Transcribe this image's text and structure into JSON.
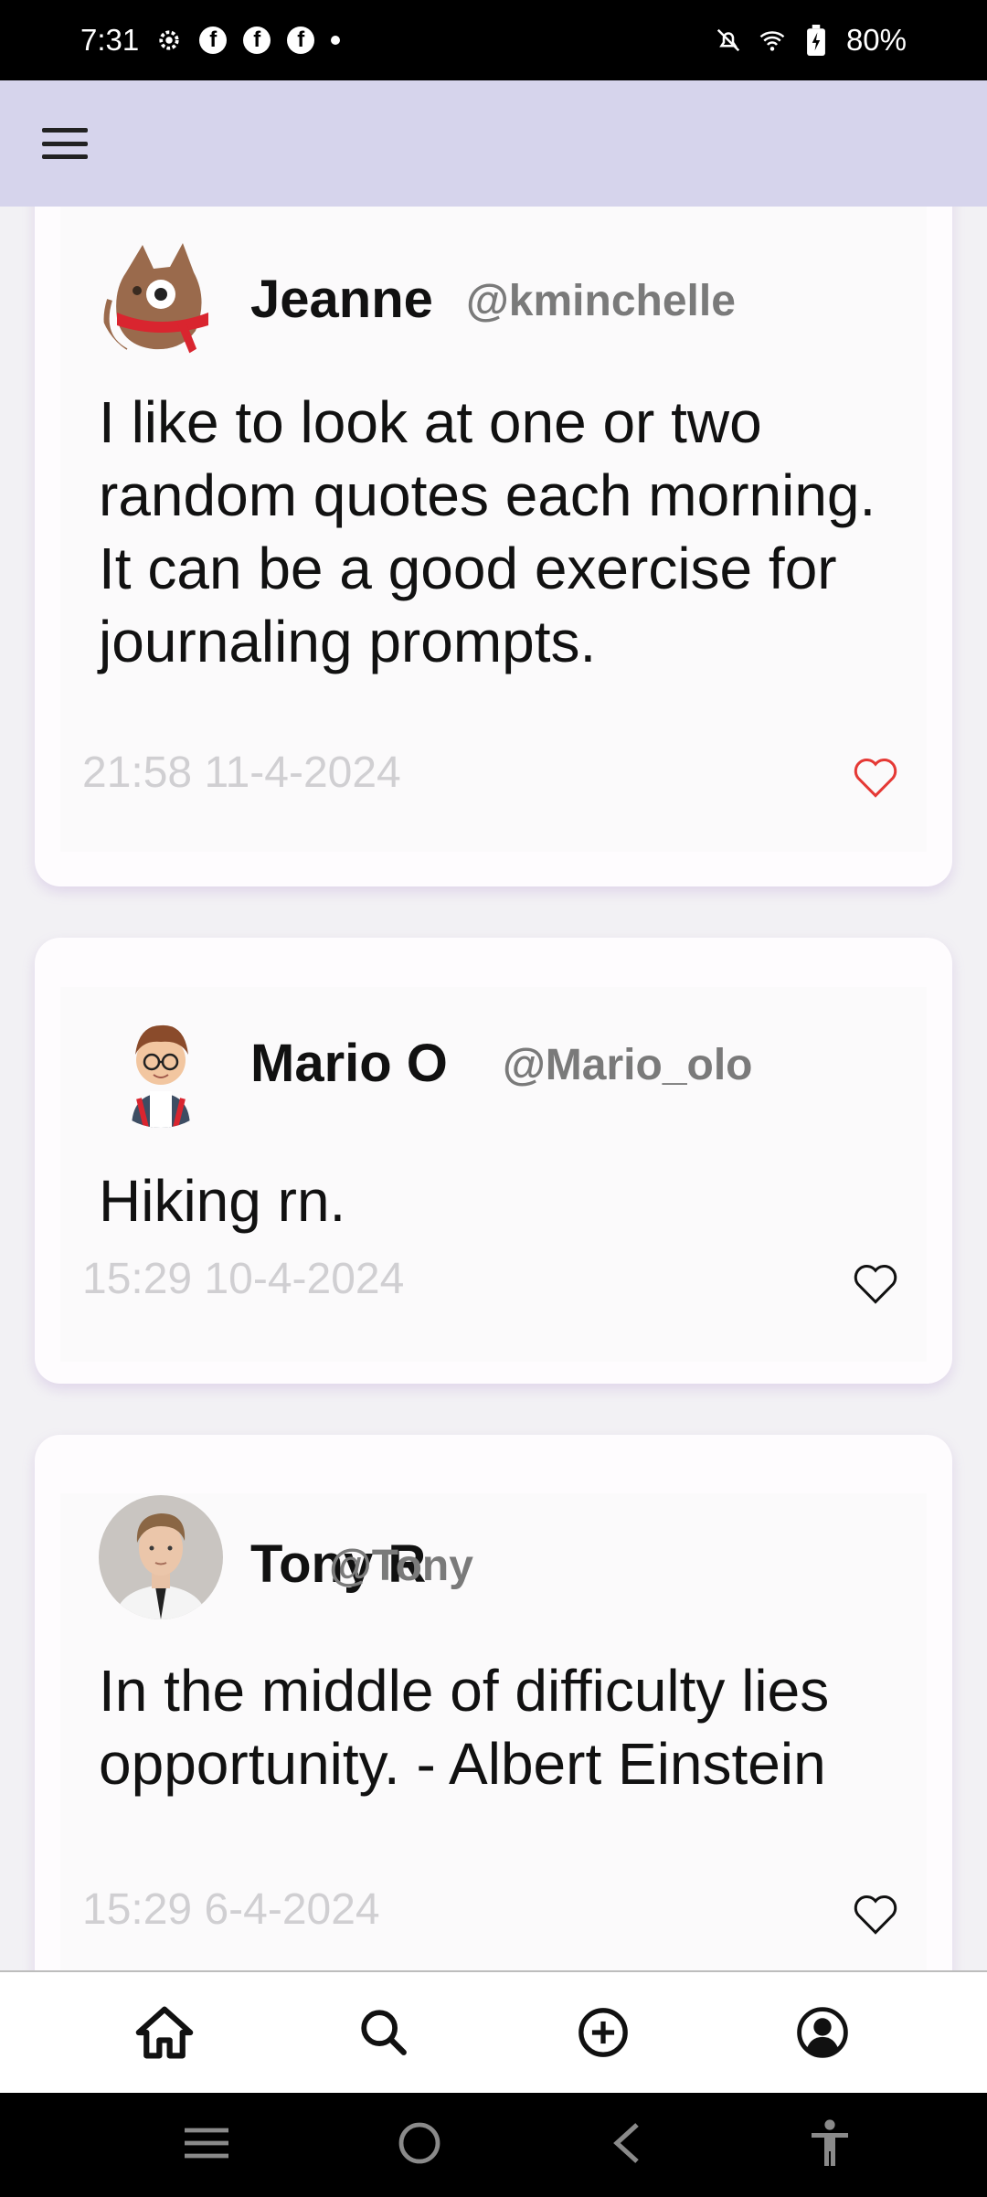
{
  "status_bar": {
    "time": "7:31",
    "battery": "80%",
    "icons": [
      "settings-icon",
      "facebook-icon",
      "facebook-icon",
      "facebook-icon",
      "dot-icon",
      "notifications-off-icon",
      "wifi-icon",
      "battery-charging-icon"
    ]
  },
  "app_bar": {
    "menu_icon": "menu-icon"
  },
  "posts": [
    {
      "name": "Jeanne",
      "handle": "@kminchelle",
      "text": "I like to look at one or two random quotes each morning. It can be a good exercise for journaling prompts.",
      "timestamp": "21:58 11-4-2024",
      "liked": true,
      "like_color": "#e53935",
      "avatar": "cat-avatar-icon"
    },
    {
      "name": "Mario O",
      "handle": "@Mario_olo",
      "text": "Hiking rn.",
      "timestamp": "15:29 10-4-2024",
      "liked": false,
      "like_color": "#111111",
      "avatar": "boy-avatar-icon"
    },
    {
      "name": "Tony R",
      "handle": "@Tony",
      "text": "In the middle of difficulty lies opportunity. - Albert Einstein",
      "timestamp": "15:29 6-4-2024",
      "liked": false,
      "like_color": "#111111",
      "avatar": "man-avatar-icon"
    }
  ],
  "bottom_nav": [
    "home-icon",
    "search-icon",
    "add-circle-icon",
    "profile-icon"
  ],
  "system_nav": [
    "recents-icon",
    "home-circle-icon",
    "back-icon",
    "accessibility-icon"
  ],
  "colors": {
    "app_bar": "#d6d4ec",
    "background": "#f2f1f4",
    "card": "#fefcfe",
    "handle": "#7a7a7a",
    "timestamp": "#d0cfd2"
  }
}
